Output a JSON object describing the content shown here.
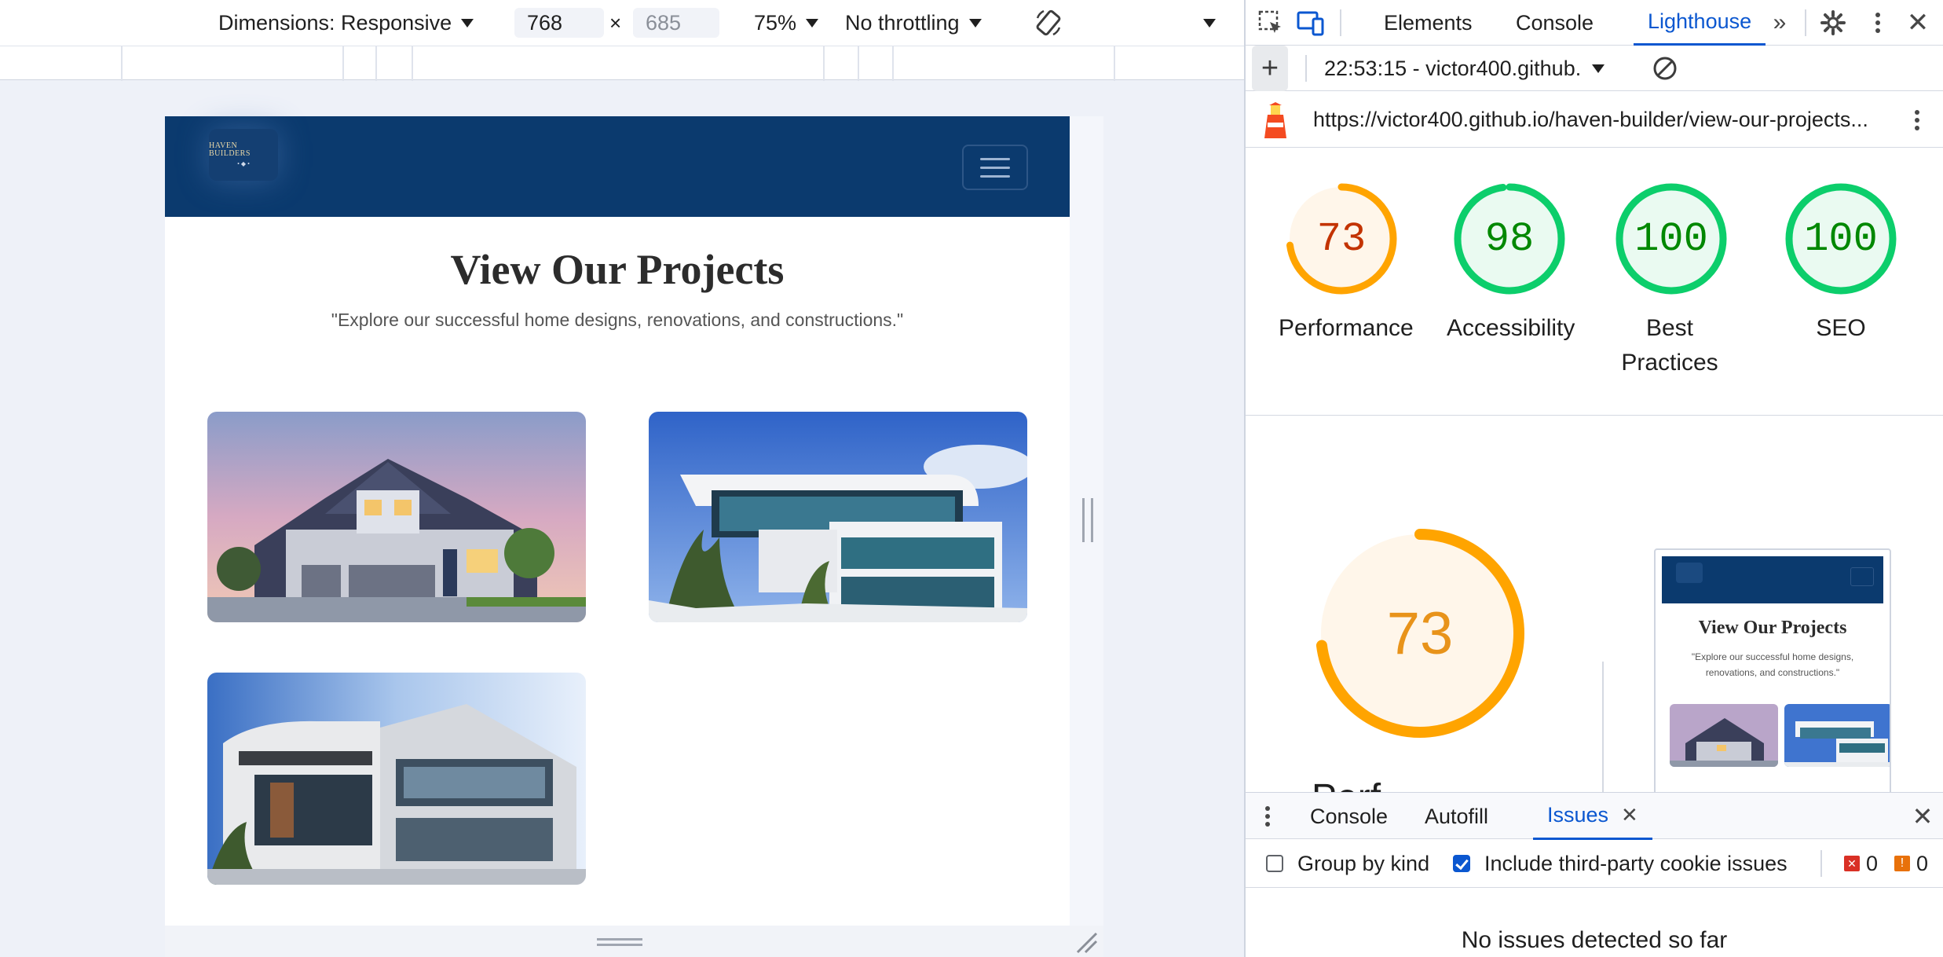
{
  "emulation_toolbar": {
    "dimensions_label": "Dimensions: Responsive",
    "width": "768",
    "height": "685",
    "times": "×",
    "zoom": "75%",
    "throttling": "No throttling"
  },
  "site": {
    "title": "View Our Projects",
    "subtitle": "\"Explore our successful home designs, renovations, and constructions.\"",
    "logo_text": "HAVEN BUILDERS"
  },
  "devtools": {
    "tabs": [
      "Elements",
      "Console",
      "Lighthouse"
    ],
    "active_tab": "Lighthouse",
    "report_selector": "22:53:15 - victor400.github.",
    "url": "https://victor400.github.io/haven-builder/view-our-projects..."
  },
  "lighthouse": {
    "scores": [
      {
        "label": "Performance",
        "score": "73",
        "value": 73,
        "status": "average"
      },
      {
        "label": "Accessibility",
        "score": "98",
        "value": 98,
        "status": "pass"
      },
      {
        "label": "Best Practices",
        "score": "100",
        "value": 100,
        "status": "pass"
      },
      {
        "label": "SEO",
        "score": "100",
        "value": 100,
        "status": "pass"
      }
    ],
    "big_score": "73",
    "big_label": "Perf",
    "colors": {
      "average": "#ffa400",
      "average_fill": "#fff6ea",
      "average_text": "#c33300",
      "pass": "#0cce6b",
      "pass_fill": "#eafaf1",
      "pass_text": "#008800"
    }
  },
  "drawer": {
    "tabs": [
      "Console",
      "Autofill",
      "Issues"
    ],
    "active_tab": "Issues",
    "group_by_kind": "Group by kind",
    "include_third_party": "Include third-party cookie issues",
    "error_count": "0",
    "warning_count": "0",
    "empty_message": "No issues detected so far"
  }
}
